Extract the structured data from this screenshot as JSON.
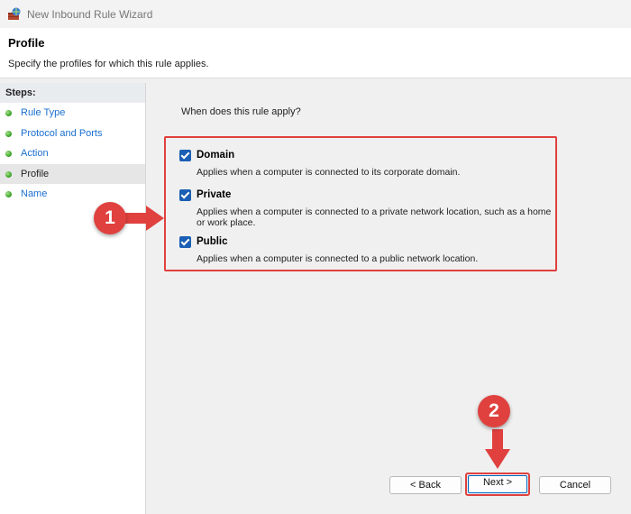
{
  "window": {
    "title": "New Inbound Rule Wizard",
    "app_icon": "firewall-rule-icon"
  },
  "header": {
    "title": "Profile",
    "subtitle": "Specify the profiles for which this rule applies."
  },
  "steps": {
    "label": "Steps:",
    "items": [
      {
        "label": "Rule Type",
        "current": false
      },
      {
        "label": "Protocol and Ports",
        "current": false
      },
      {
        "label": "Action",
        "current": false
      },
      {
        "label": "Profile",
        "current": true
      },
      {
        "label": "Name",
        "current": false
      }
    ],
    "step_icon": "green-dot-icon"
  },
  "main": {
    "question": "When does this rule apply?",
    "options": [
      {
        "label": "Domain",
        "checked": true,
        "description": "Applies when a computer is connected to its corporate domain."
      },
      {
        "label": "Private",
        "checked": true,
        "description": "Applies when a computer is connected to a private network location, such as a home or work place."
      },
      {
        "label": "Public",
        "checked": true,
        "description": "Applies when a computer is connected to a public network location."
      }
    ]
  },
  "buttons": {
    "back": "< Back",
    "next": "Next >",
    "cancel": "Cancel"
  },
  "annotations": {
    "callout_1": "1",
    "callout_2": "2",
    "highlight_color": "#e0413e"
  },
  "colors": {
    "checkbox": "#1a5fb4",
    "link": "#1a6fd0"
  }
}
